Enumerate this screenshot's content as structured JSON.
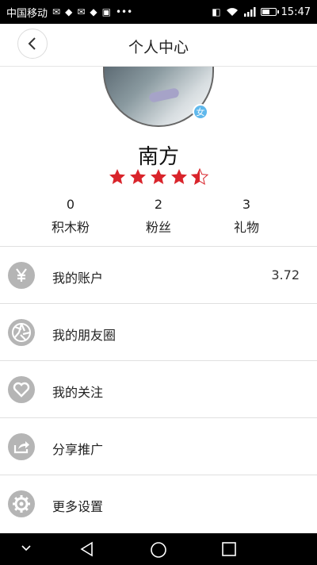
{
  "status": {
    "carrier": "中国移动",
    "time": "15:47"
  },
  "header": {
    "title": "个人中心"
  },
  "profile": {
    "name": "南方",
    "gender_badge": "女",
    "rating": 4.5,
    "stats": [
      {
        "value": "0",
        "label": "积木粉"
      },
      {
        "value": "2",
        "label": "粉丝"
      },
      {
        "value": "3",
        "label": "礼物"
      }
    ]
  },
  "menu": [
    {
      "label": "我的账户",
      "value": "3.72",
      "icon": "yuan-icon"
    },
    {
      "label": "我的朋友圈",
      "value": "",
      "icon": "aperture-icon"
    },
    {
      "label": "我的关注",
      "value": "",
      "icon": "heart-icon"
    },
    {
      "label": "分享推广",
      "value": "",
      "icon": "share-icon"
    },
    {
      "label": "更多设置",
      "value": "",
      "icon": "gear-icon"
    }
  ],
  "colors": {
    "star": "#d9242b",
    "icon_bg": "#b5b5b5",
    "badge": "#5fb8ec"
  }
}
